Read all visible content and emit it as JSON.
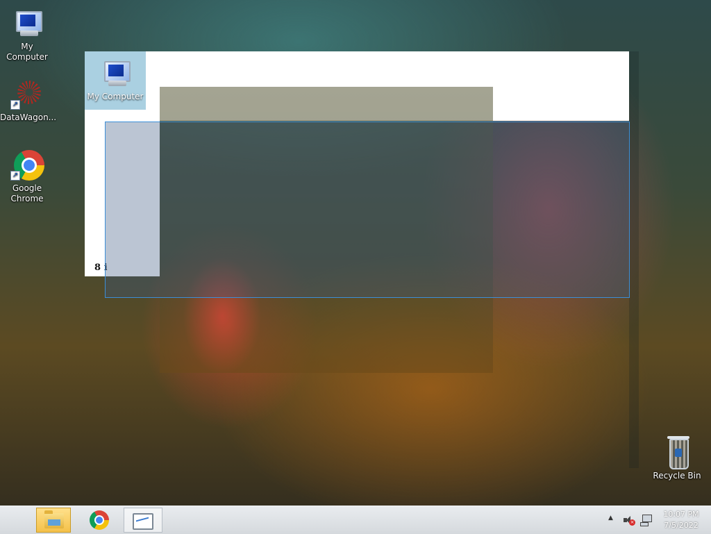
{
  "desktop": {
    "icons": [
      {
        "label": "My Computer"
      },
      {
        "label": "DataWagon..."
      },
      {
        "label": "Google Chrome"
      },
      {
        "label": "Recycle Bin"
      }
    ]
  },
  "window": {
    "selected_icon_label": "My Computer",
    "fragment_text": "8 i"
  },
  "taskbar": {
    "buttons": [
      {
        "name": "File Explorer",
        "icon": "folder-icon",
        "state": "active"
      },
      {
        "name": "Google Chrome",
        "icon": "chrome-icon",
        "state": "pinned"
      },
      {
        "name": "Performance Monitor",
        "icon": "performance-monitor-icon",
        "state": "open"
      }
    ],
    "tray": {
      "icons": [
        "show-hidden-icons-arrow",
        "speaker-muted-icon",
        "network-icon"
      ],
      "time": "10:07 PM",
      "date": "7/5/2022"
    }
  },
  "colors": {
    "selection_border": "#3c8fd8",
    "taskbar_active": "#f4c14a"
  }
}
